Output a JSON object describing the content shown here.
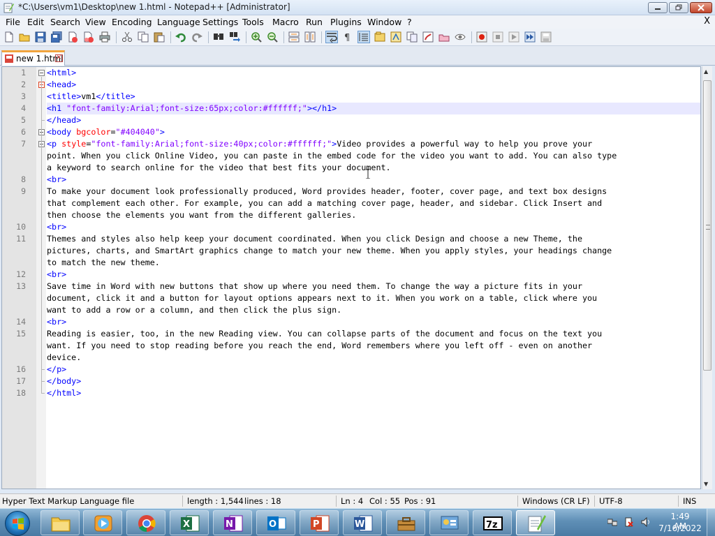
{
  "window": {
    "title": "*C:\\Users\\vm1\\Desktop\\new 1.html - Notepad++ [Administrator]",
    "menu_close": "X"
  },
  "menu": [
    "File",
    "Edit",
    "Search",
    "View",
    "Encoding",
    "Language",
    "Settings",
    "Tools",
    "Macro",
    "Run",
    "Plugins",
    "Window",
    "?"
  ],
  "toolbar_icons": [
    "new-file-icon",
    "open-file-icon",
    "save-icon",
    "save-all-icon",
    "close-icon",
    "close-all-icon",
    "print-icon",
    "cut-icon",
    "copy-icon",
    "paste-icon",
    "undo-icon",
    "redo-icon",
    "find-icon",
    "replace-icon",
    "zoom-in-icon",
    "zoom-out-icon",
    "sync-vertical-icon",
    "sync-horizontal-icon",
    "word-wrap-icon",
    "show-all-chars-icon",
    "indent-guide-icon",
    "user-defined-language-icon",
    "doc-map-icon",
    "function-list-icon",
    "folder-workspace-icon",
    "monitoring-icon",
    "record-macro-icon",
    "stop-macro-icon",
    "play-macro-icon",
    "run-macro-multiple-icon",
    "save-macro-icon"
  ],
  "tab": {
    "label": "new 1.html"
  },
  "lines": [
    {
      "n": "1",
      "tokens": [
        {
          "t": "tag",
          "v": "<html>"
        }
      ]
    },
    {
      "n": "2",
      "tokens": [
        {
          "t": "tag",
          "v": "<head>"
        }
      ]
    },
    {
      "n": "3",
      "tokens": [
        {
          "t": "tag",
          "v": "<title>"
        },
        {
          "t": "txt",
          "v": "vm1"
        },
        {
          "t": "tag",
          "v": "</title>"
        }
      ]
    },
    {
      "n": "4",
      "tokens": [
        {
          "t": "tag",
          "v": "<h1 "
        },
        {
          "t": "str",
          "v": "\"font-family:Arial;font-size:65px;color:#ffffff;\""
        },
        {
          "t": "tag",
          "v": "></h1>"
        }
      ]
    },
    {
      "n": "5",
      "tokens": [
        {
          "t": "tag",
          "v": "</head>"
        }
      ]
    },
    {
      "n": "6",
      "tokens": [
        {
          "t": "tag",
          "v": "<body "
        },
        {
          "t": "attr",
          "v": "bgcolor"
        },
        {
          "t": "txt",
          "v": "="
        },
        {
          "t": "str",
          "v": "\"#404040\""
        },
        {
          "t": "tag",
          "v": ">"
        }
      ]
    },
    {
      "n": "7",
      "tokens": [
        {
          "t": "tag",
          "v": "<p "
        },
        {
          "t": "attr",
          "v": "style"
        },
        {
          "t": "txt",
          "v": "="
        },
        {
          "t": "str",
          "v": "\"font-family:Arial;font-size:40px;color:#ffffff;\""
        },
        {
          "t": "tag",
          "v": ">"
        },
        {
          "t": "txt",
          "v": "Video provides a powerful way to help you prove your"
        }
      ]
    },
    {
      "n": "",
      "tokens": [
        {
          "t": "txt",
          "v": "point. When you click Online Video, you can paste in the embed code for the video you want to add. You can also type"
        }
      ]
    },
    {
      "n": "",
      "tokens": [
        {
          "t": "txt",
          "v": "a keyword to search online for the video that best fits your document."
        }
      ]
    },
    {
      "n": "8",
      "tokens": [
        {
          "t": "tag",
          "v": "<br>"
        }
      ]
    },
    {
      "n": "9",
      "tokens": [
        {
          "t": "txt",
          "v": "To make your document look professionally produced, Word provides header, footer, cover page, and text box designs"
        }
      ]
    },
    {
      "n": "",
      "tokens": [
        {
          "t": "txt",
          "v": "that complement each other. For example, you can add a matching cover page, header, and sidebar. Click Insert and"
        }
      ]
    },
    {
      "n": "",
      "tokens": [
        {
          "t": "txt",
          "v": "then choose the elements you want from the different galleries."
        }
      ]
    },
    {
      "n": "10",
      "tokens": [
        {
          "t": "tag",
          "v": "<br>"
        }
      ]
    },
    {
      "n": "11",
      "tokens": [
        {
          "t": "txt",
          "v": "Themes and styles also help keep your document coordinated. When you click Design and choose a new Theme, the"
        }
      ]
    },
    {
      "n": "",
      "tokens": [
        {
          "t": "txt",
          "v": "pictures, charts, and SmartArt graphics change to match your new theme. When you apply styles, your headings change"
        }
      ]
    },
    {
      "n": "",
      "tokens": [
        {
          "t": "txt",
          "v": "to match the new theme."
        }
      ]
    },
    {
      "n": "12",
      "tokens": [
        {
          "t": "tag",
          "v": "<br>"
        }
      ]
    },
    {
      "n": "13",
      "tokens": [
        {
          "t": "txt",
          "v": "Save time in Word with new buttons that show up where you need them. To change the way a picture fits in your"
        }
      ]
    },
    {
      "n": "",
      "tokens": [
        {
          "t": "txt",
          "v": "document, click it and a button for layout options appears next to it. When you work on a table, click where you"
        }
      ]
    },
    {
      "n": "",
      "tokens": [
        {
          "t": "txt",
          "v": "want to add a row or a column, and then click the plus sign."
        }
      ]
    },
    {
      "n": "14",
      "tokens": [
        {
          "t": "tag",
          "v": "<br>"
        }
      ]
    },
    {
      "n": "15",
      "tokens": [
        {
          "t": "txt",
          "v": "Reading is easier, too, in the new Reading view. You can collapse parts of the document and focus on the text you"
        }
      ]
    },
    {
      "n": "",
      "tokens": [
        {
          "t": "txt",
          "v": "want. If you need to stop reading before you reach the end, Word remembers where you left off - even on another"
        }
      ]
    },
    {
      "n": "",
      "tokens": [
        {
          "t": "txt",
          "v": "device."
        }
      ]
    },
    {
      "n": "16",
      "tokens": [
        {
          "t": "tag",
          "v": "</p>"
        }
      ]
    },
    {
      "n": "17",
      "tokens": [
        {
          "t": "tag",
          "v": "</body>"
        }
      ]
    },
    {
      "n": "18",
      "tokens": [
        {
          "t": "tag",
          "v": "</html>"
        }
      ]
    }
  ],
  "status": {
    "file_type": "Hyper Text Markup Language file",
    "length": "length : 1,544",
    "lines": "lines : 18",
    "ln": "Ln : 4",
    "col": "Col : 55",
    "pos": "Pos : 91",
    "eol": "Windows (CR LF)",
    "encoding": "UTF-8",
    "mode": "INS"
  },
  "taskbar": {
    "apps": [
      "file-explorer-icon",
      "media-player-icon",
      "chrome-icon",
      "excel-icon",
      "onenote-icon",
      "outlook-icon",
      "powerpoint-icon",
      "word-icon",
      "network-toolbox-icon",
      "control-panel-icon",
      "7zip-icon",
      "notepad-plus-plus-icon"
    ],
    "tray_icons": [
      "network-icon",
      "action-center-icon",
      "volume-icon"
    ],
    "time": "1:49 AM",
    "date": "7/16/2022"
  },
  "colors": {
    "tag": "#0000ff",
    "attribute": "#ff0000",
    "string": "#8000ff",
    "text": "#000000",
    "current_line": "#e8e8ff",
    "tab_accent": "#f1a43c"
  }
}
